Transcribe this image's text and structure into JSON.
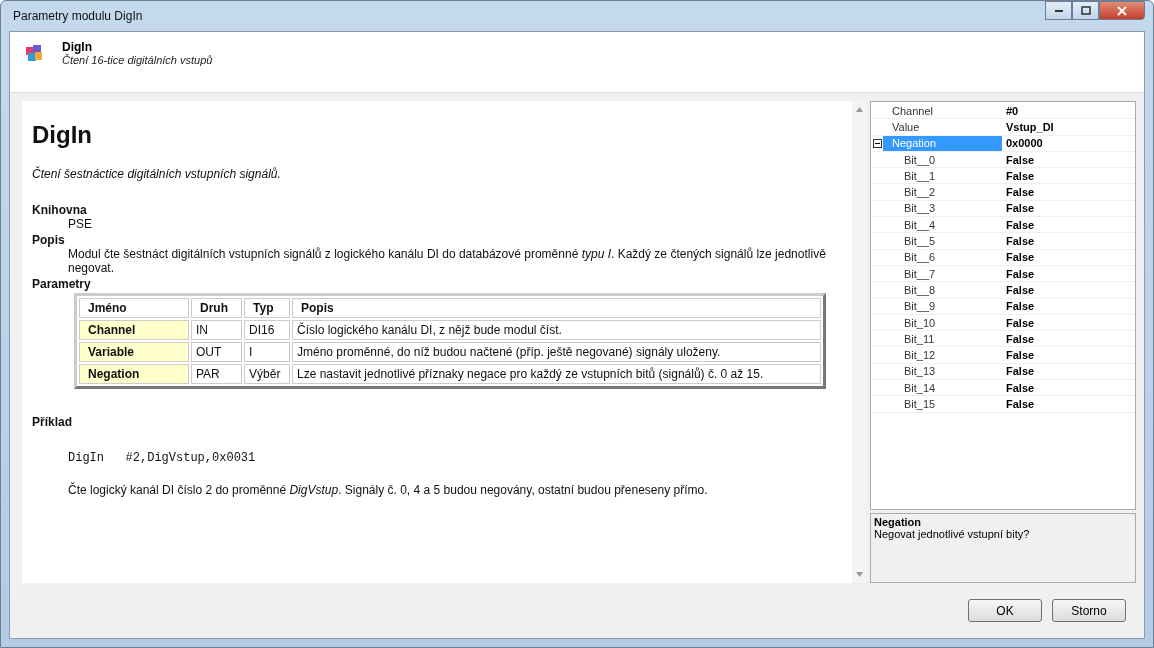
{
  "window": {
    "title": "Parametry modulu DigIn"
  },
  "header": {
    "title": "DigIn",
    "subtitle": "Čtení 16-tice digitálních vstupů"
  },
  "help": {
    "title": "DigIn",
    "summary": "Čtení šestnáctice digitálních vstupních signálů.",
    "library_heading": "Knihovna",
    "library": "PSE",
    "description_heading": "Popis",
    "description": "Modul čte šestnáct digitálních vstupních signálů z logického kanálu DI do databázové proměnné *typu I*. Každý ze čtených signálů lze jednotlivě negovat.",
    "parameters_heading": "Parametry",
    "parameters_table": {
      "columns": [
        "Jméno",
        "Druh",
        "Typ",
        "Popis"
      ],
      "rows": [
        {
          "name": "Channel",
          "kind": "IN",
          "type": "DI16",
          "description": "Číslo logického kanálu DI, z nějž bude modul číst."
        },
        {
          "name": "Variable",
          "kind": "OUT",
          "type": "I",
          "description": "Jméno proměnné, do níž budou načtené (příp. ještě negované) signály uloženy."
        },
        {
          "name": "Negation",
          "kind": "PAR",
          "type": "Výběr",
          "description": "Lze nastavit jednotlivé příznaky negace pro každý ze vstupních bitů (signálů) č. 0 až 15."
        }
      ]
    },
    "example_heading": "Příklad",
    "example_code": "DigIn   #2,DigVstup,0x0031",
    "example_text": "Čte logický kanál DI číslo 2 do proměnné *DigVstup*. Signály č. 0, 4 a 5 budou negovány, ostatní budou přeneseny přímo."
  },
  "properties": [
    {
      "name": "Channel",
      "value": "#0",
      "selected": false
    },
    {
      "name": "Value",
      "value": "Vstup_DI",
      "selected": false
    },
    {
      "name": "Negation",
      "value": "0x0000",
      "selected": true,
      "expanded": true,
      "children": [
        {
          "name": "Bit__0",
          "value": "False",
          "selected": false
        },
        {
          "name": "Bit__1",
          "value": "False",
          "selected": false
        },
        {
          "name": "Bit__2",
          "value": "False",
          "selected": false
        },
        {
          "name": "Bit__3",
          "value": "False",
          "selected": false
        },
        {
          "name": "Bit__4",
          "value": "False",
          "selected": false
        },
        {
          "name": "Bit__5",
          "value": "False",
          "selected": false
        },
        {
          "name": "Bit__6",
          "value": "False",
          "selected": false
        },
        {
          "name": "Bit__7",
          "value": "False",
          "selected": false
        },
        {
          "name": "Bit__8",
          "value": "False",
          "selected": false
        },
        {
          "name": "Bit__9",
          "value": "False",
          "selected": false
        },
        {
          "name": "Bit_10",
          "value": "False",
          "selected": false
        },
        {
          "name": "Bit_11",
          "value": "False",
          "selected": false
        },
        {
          "name": "Bit_12",
          "value": "False",
          "selected": false
        },
        {
          "name": "Bit_13",
          "value": "False",
          "selected": false
        },
        {
          "name": "Bit_14",
          "value": "False",
          "selected": false
        },
        {
          "name": "Bit_15",
          "value": "False",
          "selected": false
        }
      ]
    }
  ],
  "description_panel": {
    "title": "Negation",
    "text": "Negovat jednotlivé vstupní bity?"
  },
  "buttons": [
    "OK",
    "Storno"
  ]
}
